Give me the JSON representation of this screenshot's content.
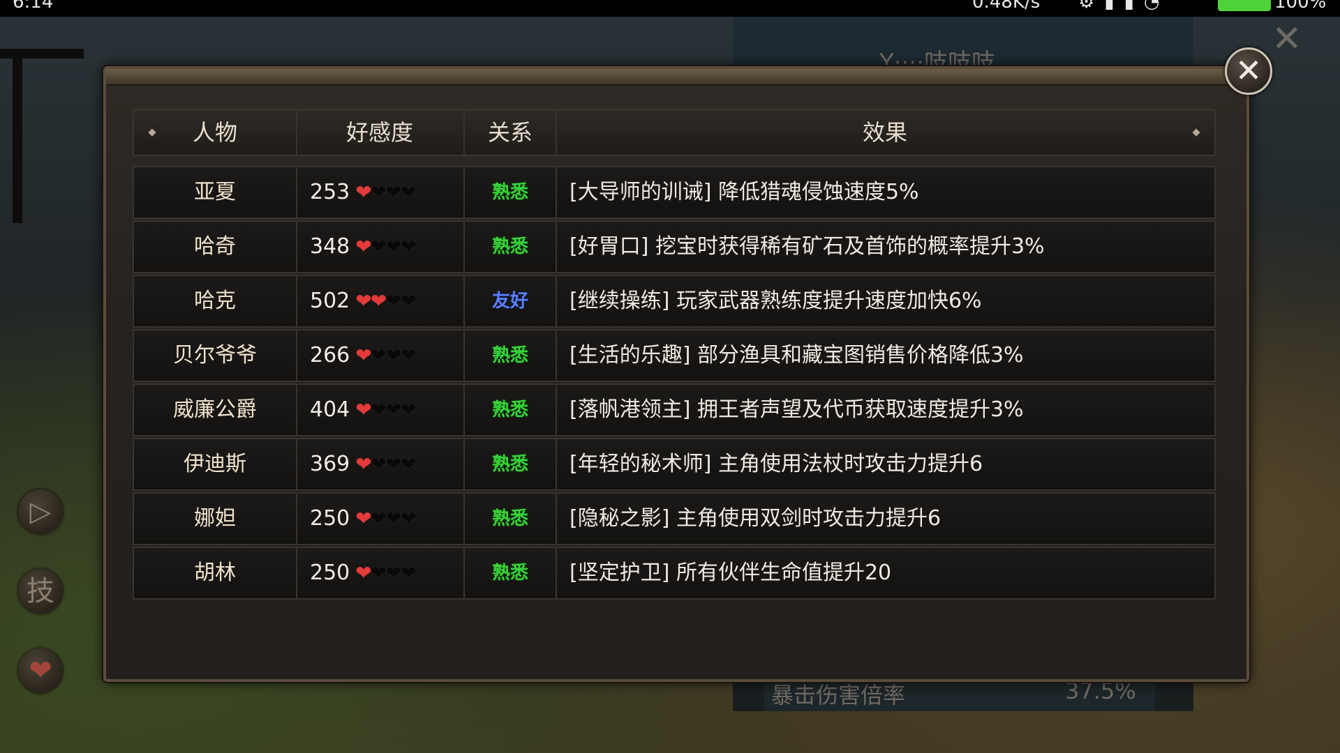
{
  "status_bar": {
    "time": "6:14",
    "speed": "0.48K/s",
    "battery": "100%"
  },
  "background": {
    "stat_label": "暴击伤害倍率",
    "stat_value": "37.5%",
    "side_button_skill": "技",
    "side_button_arrow": "▷",
    "side_button_heart": "❤",
    "title_fragment": "Y····吱吱吱"
  },
  "panel": {
    "close_symbol": "✕",
    "headers": {
      "character": "人物",
      "affinity": "好感度",
      "relation": "关系",
      "effect": "效果"
    },
    "rows": [
      {
        "name": "亚夏",
        "affinity": "253",
        "hearts_filled": 1,
        "hearts_total": 4,
        "relation": "熟悉",
        "relation_color": "green",
        "effect": "[大导师的训诫] 降低猎魂侵蚀速度5%"
      },
      {
        "name": "哈奇",
        "affinity": "348",
        "hearts_filled": 1,
        "hearts_total": 4,
        "relation": "熟悉",
        "relation_color": "green",
        "effect": "[好胃口] 挖宝时获得稀有矿石及首饰的概率提升3%"
      },
      {
        "name": "哈克",
        "affinity": "502",
        "hearts_filled": 2,
        "hearts_total": 4,
        "relation": "友好",
        "relation_color": "blue",
        "effect": "[继续操练] 玩家武器熟练度提升速度加快6%"
      },
      {
        "name": "贝尔爷爷",
        "affinity": "266",
        "hearts_filled": 1,
        "hearts_total": 4,
        "relation": "熟悉",
        "relation_color": "green",
        "effect": "[生活的乐趣] 部分渔具和藏宝图销售价格降低3%"
      },
      {
        "name": "威廉公爵",
        "affinity": "404",
        "hearts_filled": 1,
        "hearts_total": 4,
        "relation": "熟悉",
        "relation_color": "green",
        "effect": "[落帆港领主] 拥王者声望及代币获取速度提升3%"
      },
      {
        "name": "伊迪斯",
        "affinity": "369",
        "hearts_filled": 1,
        "hearts_total": 4,
        "relation": "熟悉",
        "relation_color": "green",
        "effect": "[年轻的秘术师] 主角使用法杖时攻击力提升6"
      },
      {
        "name": "娜妲",
        "affinity": "250",
        "hearts_filled": 1,
        "hearts_total": 4,
        "relation": "熟悉",
        "relation_color": "green",
        "effect": "[隐秘之影] 主角使用双剑时攻击力提升6"
      },
      {
        "name": "胡林",
        "affinity": "250",
        "hearts_filled": 1,
        "hearts_total": 4,
        "relation": "熟悉",
        "relation_color": "green",
        "effect": "[坚定护卫] 所有伙伴生命值提升20"
      }
    ]
  },
  "colors": {
    "relation_green": "#38d23a",
    "relation_blue": "#5b7fff",
    "heart_full": "#e33a3a"
  }
}
